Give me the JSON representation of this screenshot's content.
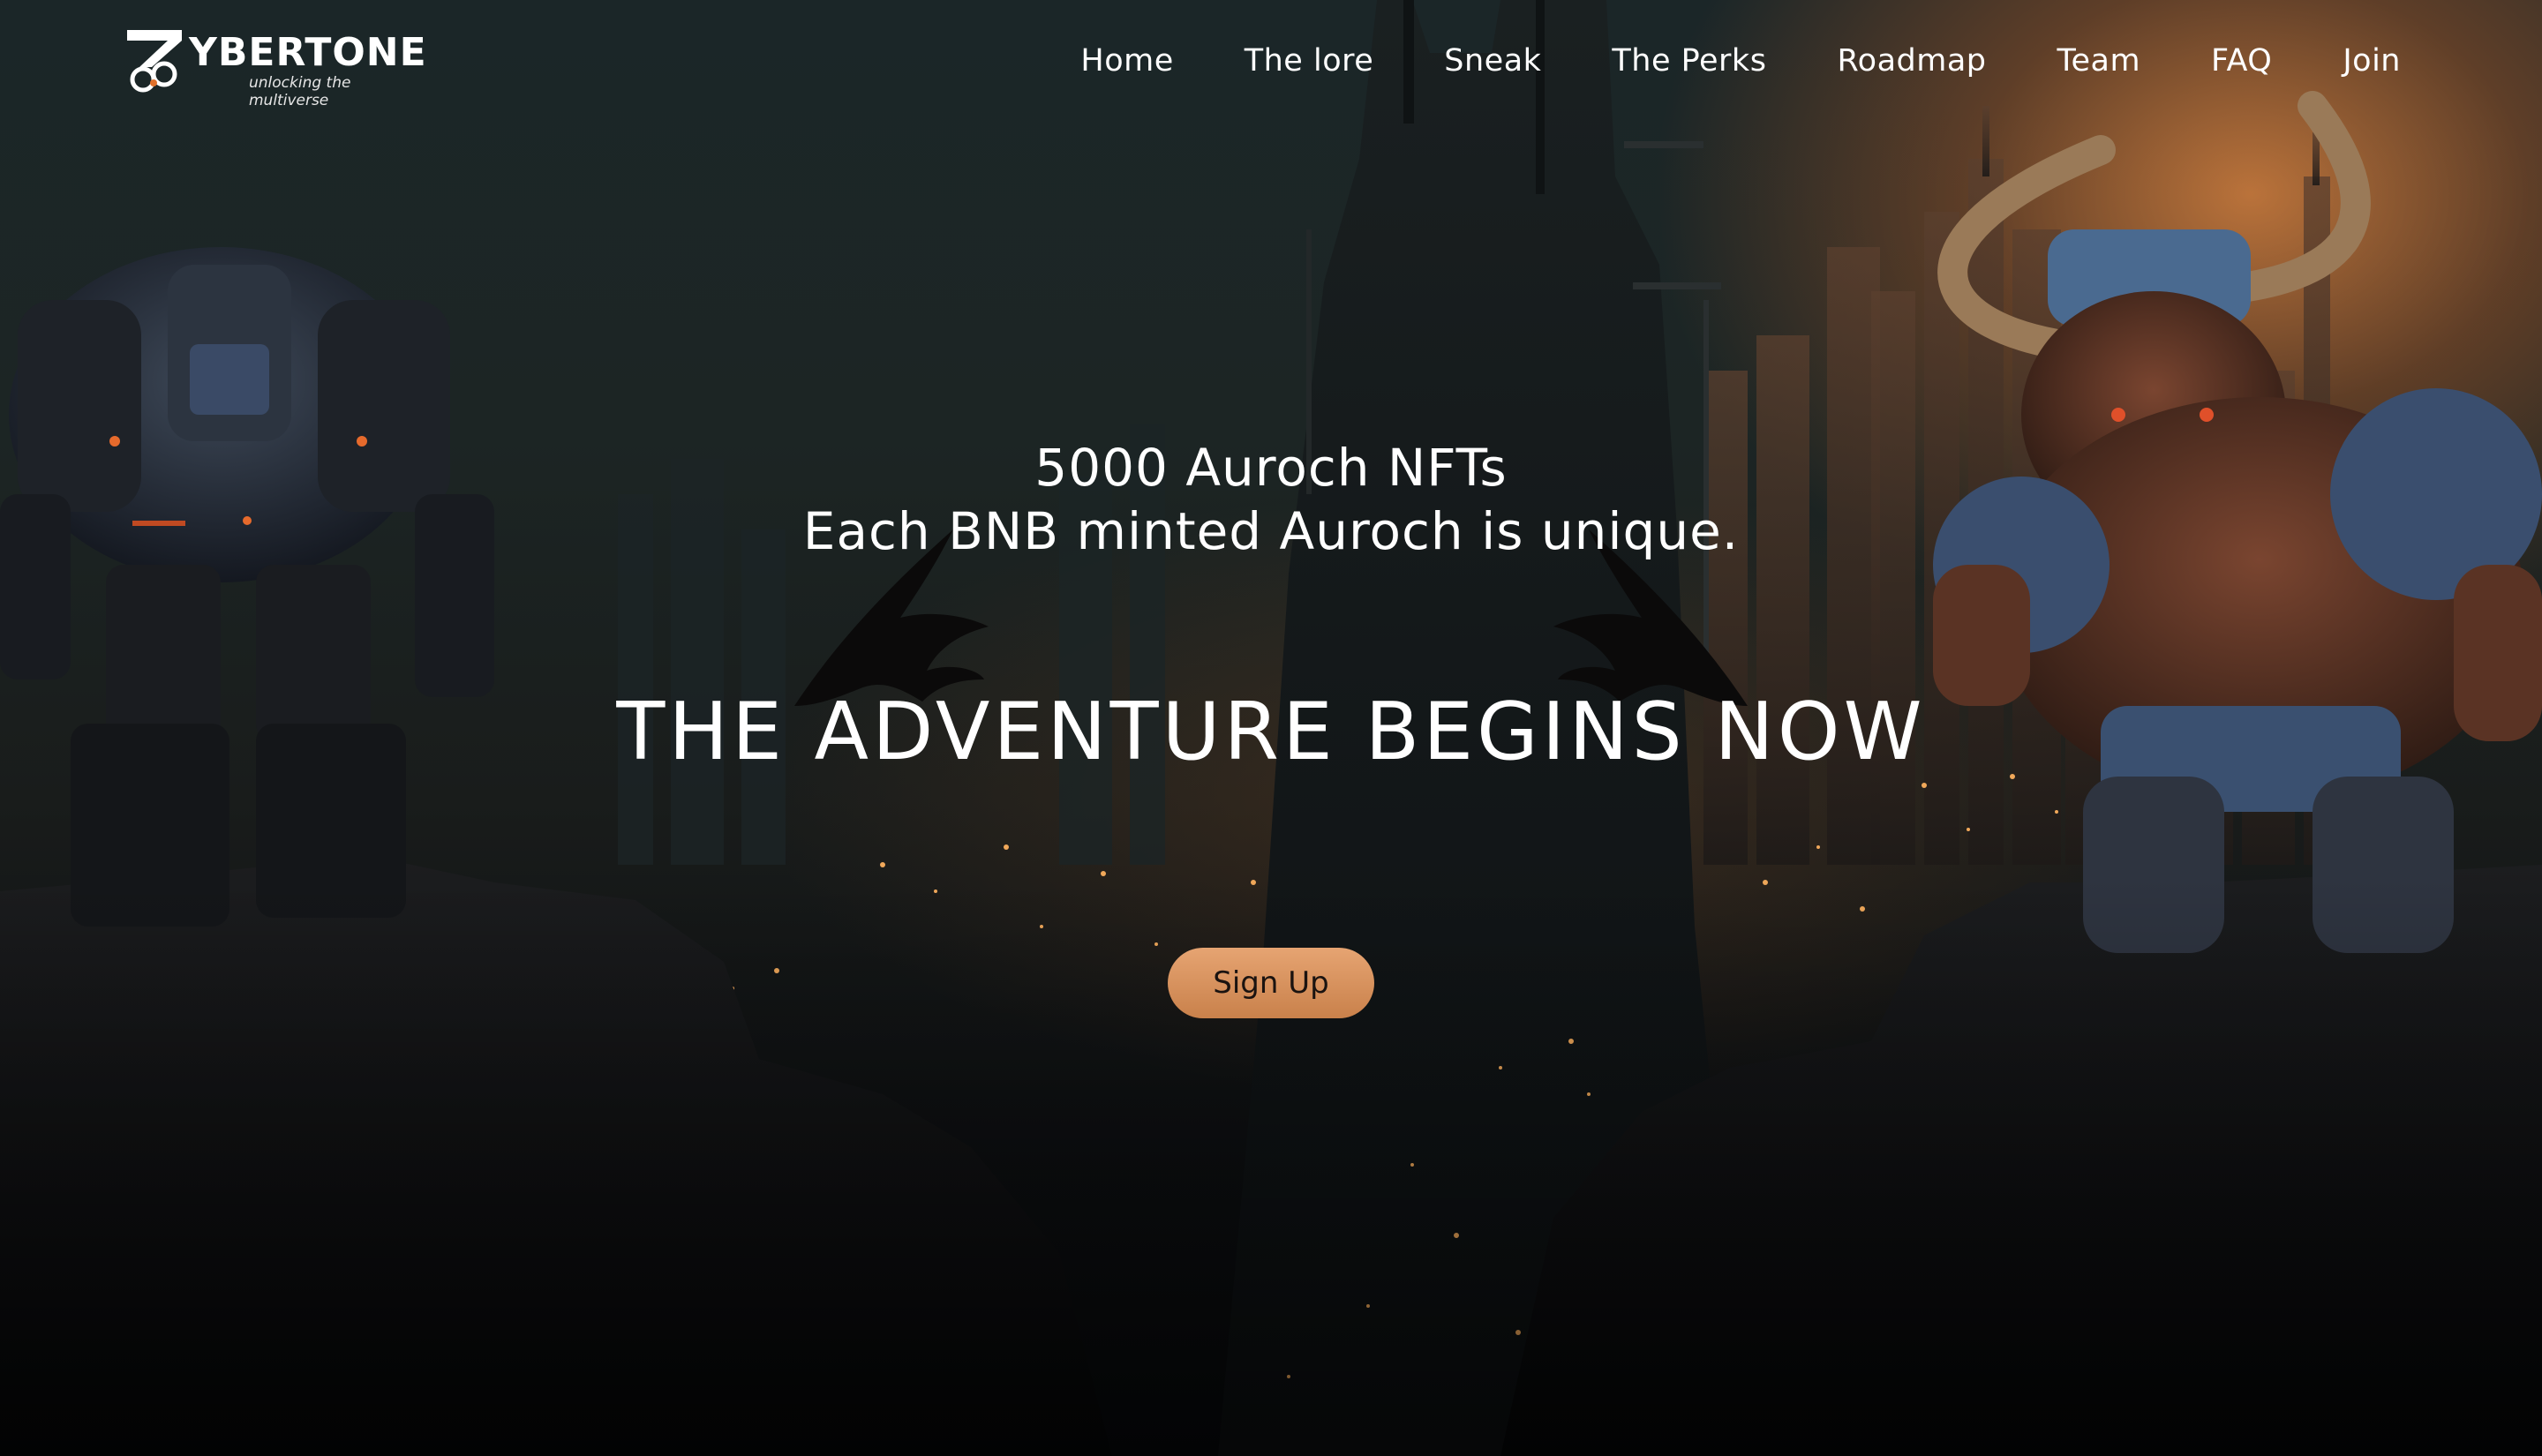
{
  "brand": {
    "name": "YBERTONE",
    "tagline": "unlocking the multiverse"
  },
  "nav": {
    "items": [
      {
        "label": "Home"
      },
      {
        "label": "The lore"
      },
      {
        "label": "Sneak"
      },
      {
        "label": "The Perks"
      },
      {
        "label": "Roadmap"
      },
      {
        "label": "Team"
      },
      {
        "label": "FAQ"
      },
      {
        "label": "Join"
      }
    ]
  },
  "hero": {
    "line1": "5000 Auroch NFTs",
    "line2": "Each BNB minted Auroch is unique.",
    "headline": "THE ADVENTURE BEGINS NOW",
    "cta_label": "Sign Up"
  },
  "colors": {
    "accent": "#d9925c",
    "sky_glow": "#d6803e",
    "background": "#0a0d10"
  },
  "icons": {
    "logo": "cybertone-logo-mark",
    "left_figure": "robot-mech-icon",
    "right_figure": "minotaur-warrior-icon",
    "birds": "raven-silhouette-icon"
  }
}
